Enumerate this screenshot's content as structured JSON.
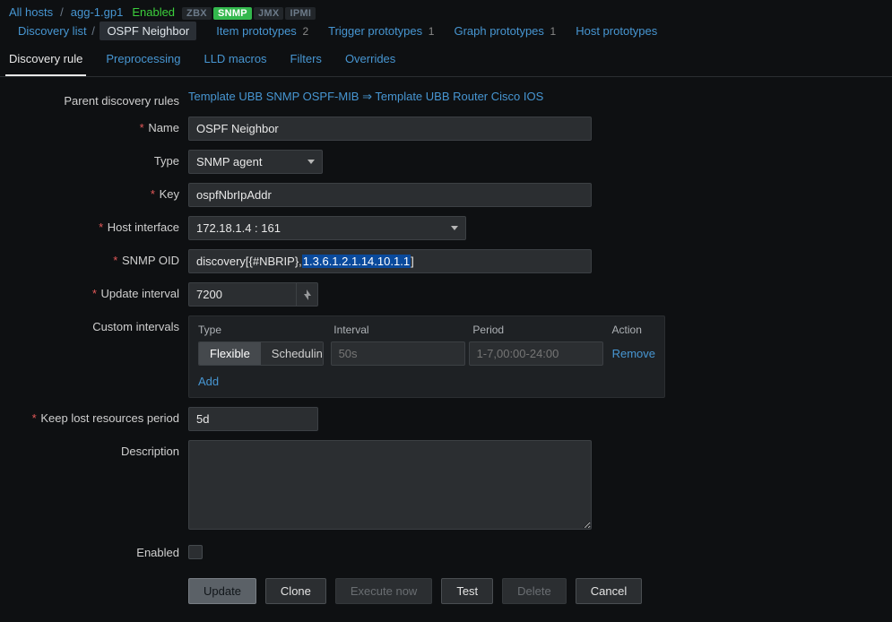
{
  "breadcrumb": {
    "all_hosts": "All hosts",
    "host": "agg-1.gp1",
    "enabled": "Enabled",
    "protocols": {
      "zbx": "ZBX",
      "snmp": "SNMP",
      "jmx": "JMX",
      "ipmi": "IPMI"
    },
    "discovery_list": "Discovery list",
    "current": "OSPF Neighbor"
  },
  "topmenu": {
    "item_proto": "Item prototypes",
    "item_proto_count": "2",
    "trigger_proto": "Trigger prototypes",
    "trigger_proto_count": "1",
    "graph_proto": "Graph prototypes",
    "graph_proto_count": "1",
    "host_proto": "Host prototypes"
  },
  "tabs": {
    "rule": "Discovery rule",
    "preprocessing": "Preprocessing",
    "lld": "LLD macros",
    "filters": "Filters",
    "overrides": "Overrides"
  },
  "form": {
    "labels": {
      "parent_rules": "Parent discovery rules",
      "name": "Name",
      "type": "Type",
      "key": "Key",
      "host_interface": "Host interface",
      "snmp_oid": "SNMP OID",
      "update_interval": "Update interval",
      "custom_intervals": "Custom intervals",
      "keep_lost": "Keep lost resources period",
      "description": "Description",
      "enabled": "Enabled"
    },
    "parent_rules": {
      "a": "Template UBB SNMP OSPF-MIB",
      "arrow": "⇒",
      "b": "Template UBB Router Cisco IOS"
    },
    "values": {
      "name": "OSPF Neighbor",
      "type": "SNMP agent",
      "key": "ospfNbrIpAddr",
      "host_interface": "172.18.1.4 : 161",
      "oid_prefix": "discovery[{#NBRIP},",
      "oid_selected": "1.3.6.1.2.1.14.10.1.1",
      "oid_suffix": "]",
      "update_interval": "7200",
      "keep_lost": "5d",
      "description": ""
    },
    "custom_intervals": {
      "headers": {
        "type": "Type",
        "interval": "Interval",
        "period": "Period",
        "action": "Action"
      },
      "flexible": "Flexible",
      "scheduling": "Scheduling",
      "row": {
        "interval_placeholder": "50s",
        "period_placeholder": "1-7,00:00-24:00"
      },
      "remove": "Remove",
      "add": "Add"
    },
    "buttons": {
      "update": "Update",
      "clone": "Clone",
      "execute": "Execute now",
      "test": "Test",
      "delete": "Delete",
      "cancel": "Cancel"
    }
  }
}
